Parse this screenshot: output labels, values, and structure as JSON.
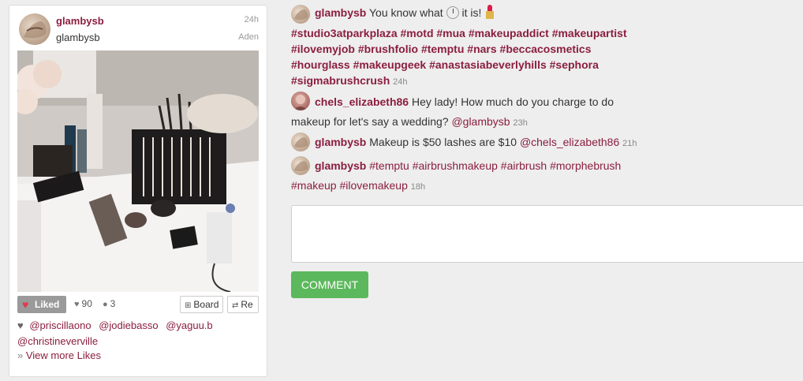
{
  "post": {
    "username": "glambysb",
    "display_name": "glambysb",
    "time": "24h",
    "location": "Aden",
    "actions": {
      "liked_label": "Liked",
      "likes_count": "90",
      "comments_count": "3",
      "board_label": "Board",
      "repost_label": "Re"
    },
    "likers": [
      "@priscillaono",
      "@jodiebasso",
      "@yaguu.b",
      "@christineverville"
    ],
    "view_more_label": "View more Likes"
  },
  "comments": [
    {
      "user": "glambysb",
      "text_a": "You know what",
      "text_b": "it is!",
      "emoji": [
        "clock-icon",
        "lipstick-icon"
      ],
      "tags_line1": [
        "#studio3atparkplaza",
        "#motd",
        "#mua",
        "#makeupaddict",
        "#makeupartist"
      ],
      "tags_line2": [
        "#ilovemyjob",
        "#brushfolio",
        "#temptu",
        "#nars",
        "#beccacosmetics"
      ],
      "tags_line3": [
        "#hourglass",
        "#makeupgeek",
        "#anastasiabeverlyhills",
        "#sephora"
      ],
      "tags_line4": [
        "#sigmabrushcrush"
      ],
      "time": "24h"
    },
    {
      "user": "chels_elizabeth86",
      "text_line1": "Hey lady! How much do you charge to do",
      "text_line2": "makeup for let's say a wedding?",
      "mention": "@glambysb",
      "time": "23h"
    },
    {
      "user": "glambysb",
      "text": "Makeup is $50 lashes are $10",
      "mention": "@chels_elizabeth86",
      "time": "21h"
    },
    {
      "user": "glambysb",
      "tags_line1": [
        "#temptu",
        "#airbrushmakeup",
        "#airbrush",
        "#morphebrush"
      ],
      "tags_line2": [
        "#makeup",
        "#ilovemakeup"
      ],
      "time": "18h"
    }
  ],
  "comment_button_label": "COMMENT",
  "colors": {
    "accent": "#8b1e3f",
    "button_green": "#5cb85c",
    "liked_grey": "#9a9a9a"
  }
}
